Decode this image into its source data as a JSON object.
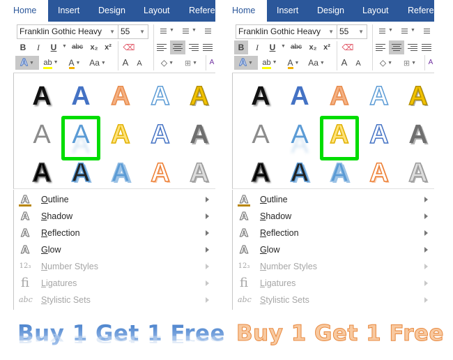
{
  "panels": [
    {
      "id": "left",
      "tabs": [
        "Home",
        "Insert",
        "Design",
        "Layout",
        "Referen"
      ],
      "active_tab": "Home",
      "font": {
        "name": "Franklin Gothic Heavy",
        "size": "55"
      },
      "ribbon": {
        "bold": "B",
        "italic": "I",
        "underline": "U",
        "strikethrough": "abc",
        "subscript": "x₂",
        "superscript": "x²",
        "highlight": "ab",
        "font_color": "A",
        "change_case": "Aa",
        "grow_font": "A",
        "shrink_font": "A",
        "text_effects": "A",
        "sort": "A"
      },
      "selected_style_index": 6,
      "gallery_label": "A",
      "menu": [
        {
          "label": "Outline",
          "enabled": true,
          "icon": "outline-icon"
        },
        {
          "label": "Shadow",
          "enabled": true,
          "icon": "shadow-icon"
        },
        {
          "label": "Reflection",
          "enabled": true,
          "icon": "reflection-icon"
        },
        {
          "label": "Glow",
          "enabled": true,
          "icon": "glow-icon"
        },
        {
          "label": "Number Styles",
          "enabled": false,
          "icon": "number-styles-icon",
          "glyph": "12₃"
        },
        {
          "label": "Ligatures",
          "enabled": false,
          "icon": "ligatures-icon",
          "glyph": "fi"
        },
        {
          "label": "Stylistic Sets",
          "enabled": false,
          "icon": "stylistic-sets-icon",
          "glyph": "abc"
        }
      ],
      "banner": "Buy 1 Get 1 Free"
    },
    {
      "id": "right",
      "tabs": [
        "Home",
        "Insert",
        "Design",
        "Layout",
        "Referen"
      ],
      "active_tab": "Home",
      "font": {
        "name": "Franklin Gothic Heavy",
        "size": "55"
      },
      "ribbon": {
        "bold": "B",
        "italic": "I",
        "underline": "U",
        "strikethrough": "abc",
        "subscript": "x₂",
        "superscript": "x²",
        "highlight": "ab",
        "font_color": "A",
        "change_case": "Aa",
        "grow_font": "A",
        "shrink_font": "A",
        "text_effects": "A",
        "sort": "A"
      },
      "selected_style_index": 7,
      "gallery_label": "A",
      "menu": [
        {
          "label": "Outline",
          "enabled": true,
          "icon": "outline-icon"
        },
        {
          "label": "Shadow",
          "enabled": true,
          "icon": "shadow-icon"
        },
        {
          "label": "Reflection",
          "enabled": true,
          "icon": "reflection-icon"
        },
        {
          "label": "Glow",
          "enabled": true,
          "icon": "glow-icon"
        },
        {
          "label": "Number Styles",
          "enabled": false,
          "icon": "number-styles-icon",
          "glyph": "12₃"
        },
        {
          "label": "Ligatures",
          "enabled": false,
          "icon": "ligatures-icon",
          "glyph": "fi"
        },
        {
          "label": "Stylistic Sets",
          "enabled": false,
          "icon": "stylistic-sets-icon",
          "glyph": "abc"
        }
      ],
      "banner": "Buy 1 Get 1 Free"
    }
  ],
  "colors": {
    "tab_bar": "#2b579a",
    "selection_highlight": "#00dd00",
    "banner_left": "#5b8ed0",
    "banner_right_fill": "#f8c9a0",
    "banner_right_outline": "#e8893f"
  },
  "gallery_styles": [
    {
      "name": "black-fill-shadow",
      "fill": "#111111",
      "stroke": "none"
    },
    {
      "name": "blue-fill",
      "fill": "#4472c4",
      "stroke": "none"
    },
    {
      "name": "orange-fill-outline",
      "fill": "#f4b183",
      "stroke": "#e88a4a"
    },
    {
      "name": "white-outline-blue",
      "fill": "#ffffff",
      "stroke": "#5b9bd5"
    },
    {
      "name": "gold-bevel",
      "fill": "#f2c200",
      "stroke": "#b38f00"
    },
    {
      "name": "gray-fill",
      "fill": "#8c8c8c",
      "stroke": "none"
    },
    {
      "name": "blue-reflection",
      "fill": "#5b9bd5",
      "stroke": "none"
    },
    {
      "name": "yellow-fill-outline",
      "fill": "#ffe27a",
      "stroke": "#e0b000"
    },
    {
      "name": "white-outline-dark-blue",
      "fill": "#ffffff",
      "stroke": "#4472c4"
    },
    {
      "name": "gray-bevel",
      "fill": "#6f6f6f",
      "stroke": "none"
    },
    {
      "name": "black-heavy-shadow",
      "fill": "#000000",
      "stroke": "#555555"
    },
    {
      "name": "black-blue-shadow",
      "fill": "#222222",
      "stroke": "#5b9bd5"
    },
    {
      "name": "blue-heavy-shadow",
      "fill": "#5b9bd5",
      "stroke": "#9dc3e6"
    },
    {
      "name": "white-outline-orange",
      "fill": "#ffffff",
      "stroke": "#ed7d31"
    },
    {
      "name": "light-gray-bevel",
      "fill": "#dddddd",
      "stroke": "#9a9a9a"
    }
  ]
}
